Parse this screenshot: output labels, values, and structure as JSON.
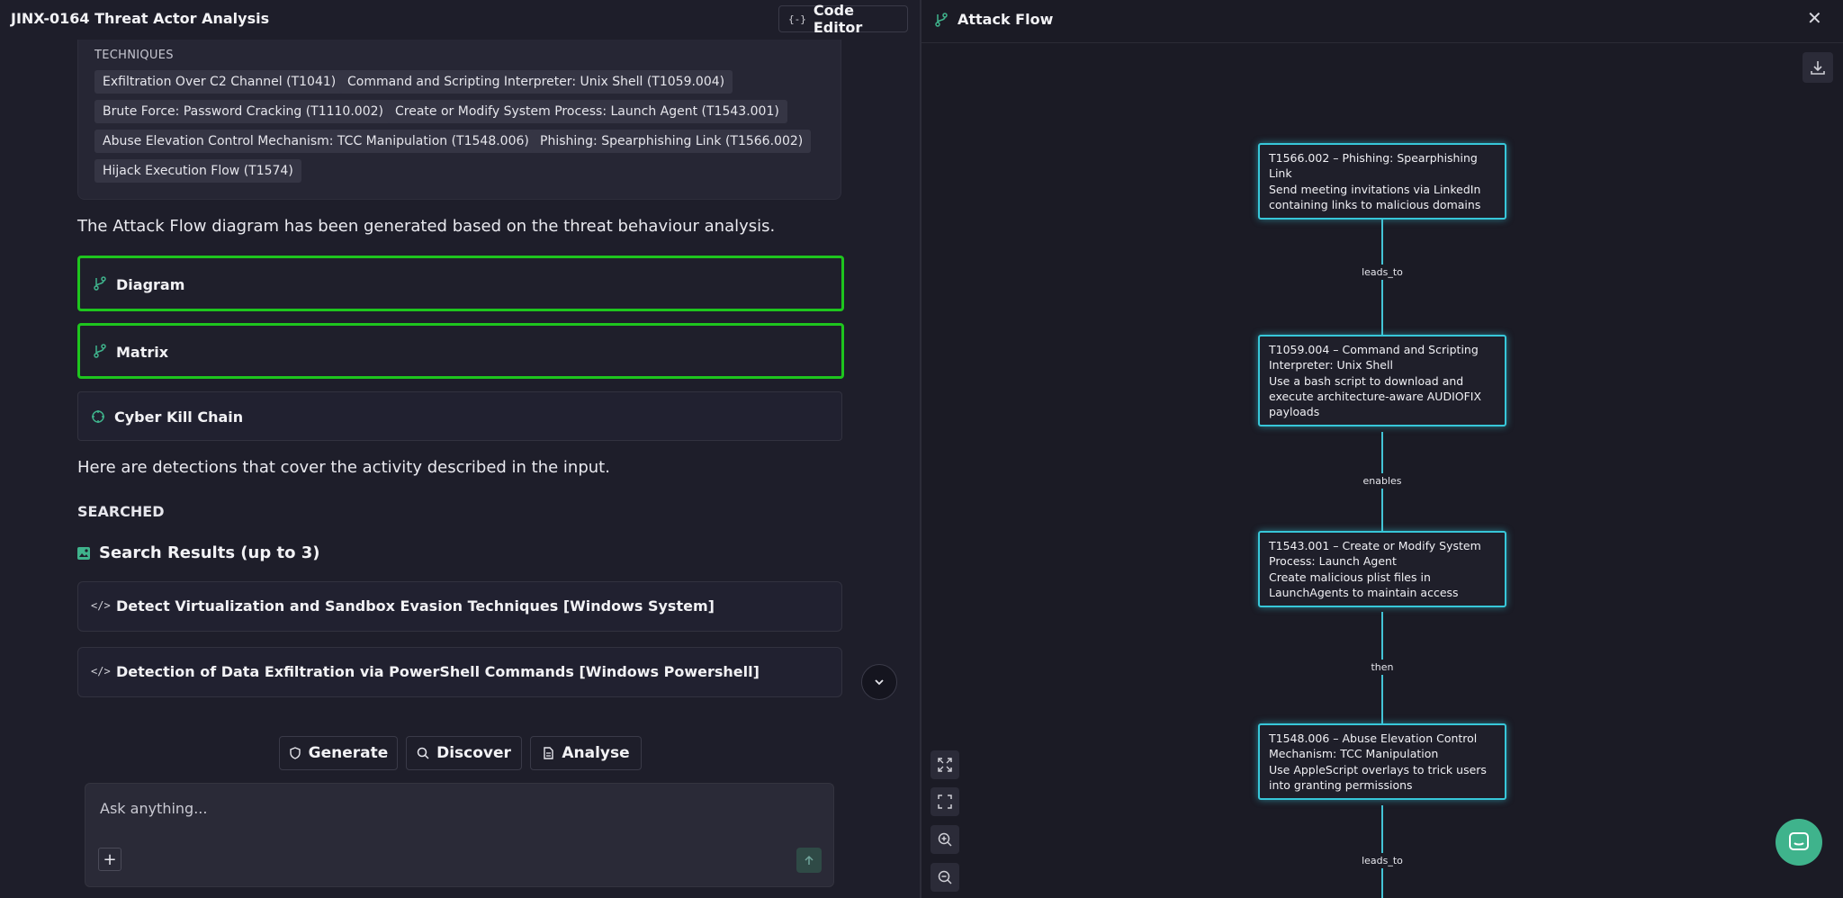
{
  "app": {
    "title": "JINX-0164 Threat Actor Analysis",
    "code_editor_label": "Code Editor",
    "code_editor_icon": "{-}"
  },
  "techniques": {
    "heading": "TECHNIQUES",
    "items": [
      "Exfiltration Over C2 Channel (T1041)",
      "Command and Scripting Interpreter: Unix Shell (T1059.004)",
      "Brute Force: Password Cracking (T1110.002)",
      "Create or Modify System Process: Launch Agent (T1543.001)",
      "Abuse Elevation Control Mechanism: TCC Manipulation (T1548.006)",
      "Phishing: Spearphishing Link (T1566.002)",
      "Hijack Execution Flow (T1574)"
    ]
  },
  "messages": {
    "attack_flow_note": "The Attack Flow diagram has been generated based on the threat behaviour analysis.",
    "detections_note": "Here are detections that cover the activity described in the input."
  },
  "flow_buttons": {
    "diagram": "Diagram",
    "matrix": "Matrix",
    "kill_chain": "Cyber Kill Chain"
  },
  "search": {
    "searched_label": "SEARCHED",
    "results_heading": "Search Results (up to 3)",
    "results": [
      "Detect Virtualization and Sandbox Evasion Techniques [Windows System]",
      "Detection of Data Exfiltration via PowerShell Commands [Windows Powershell]"
    ]
  },
  "actions": {
    "generate": "Generate",
    "discover": "Discover",
    "analyse": "Analyse"
  },
  "composer": {
    "placeholder": "Ask anything..."
  },
  "attack_flow": {
    "title": "Attack Flow",
    "nodes": [
      {
        "title": "T1566.002 – Phishing: Spearphishing Link",
        "desc": "Send meeting invitations via LinkedIn containing links to malicious domains"
      },
      {
        "title": "T1059.004 – Command and Scripting Interpreter: Unix Shell",
        "desc": "Use a bash script to download and execute architecture-aware AUDIOFIX payloads"
      },
      {
        "title": "T1543.001 – Create or Modify System Process: Launch Agent",
        "desc": "Create malicious plist files in LaunchAgents to maintain access"
      },
      {
        "title": "T1548.006 – Abuse Elevation Control Mechanism: TCC Manipulation",
        "desc": "Use AppleScript overlays to trick users into granting permissions"
      }
    ],
    "edges": [
      "leads_to",
      "enables",
      "then",
      "leads_to"
    ]
  },
  "colors": {
    "highlight": "#1ec51e",
    "node_border": "#37c7d9",
    "accent": "#3fb38c"
  }
}
